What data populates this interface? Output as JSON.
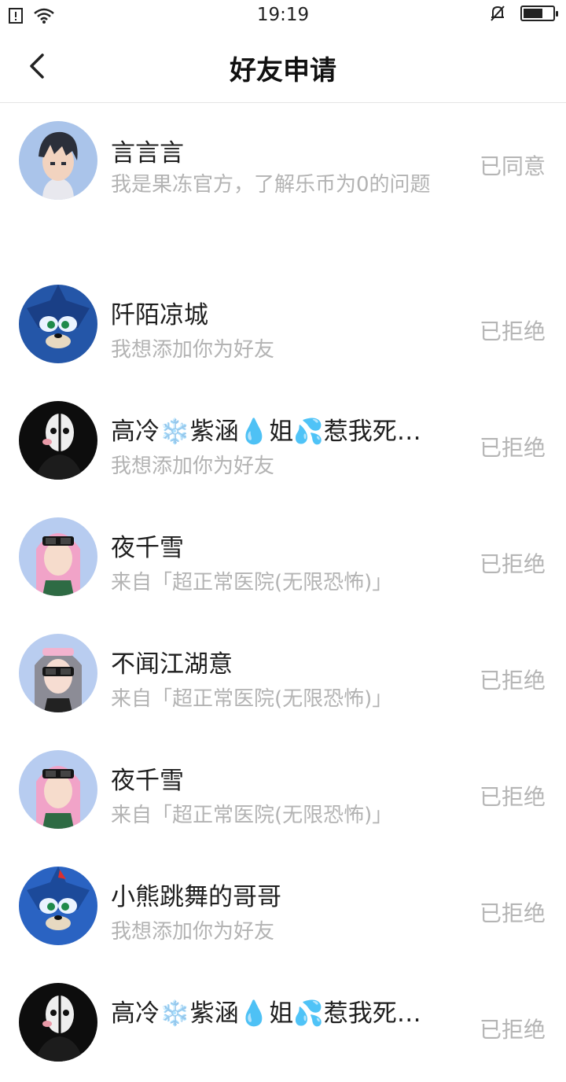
{
  "status_bar": {
    "time": "19:19"
  },
  "header": {
    "title": "好友申请"
  },
  "requests": [
    {
      "name": "言言言",
      "message": "我是果冻官方，了解乐币为0的问题",
      "status": "已同意",
      "avatar": "anime-boy-avatar"
    },
    {
      "name": "阡陌凉城",
      "message": "我想添加你为好友",
      "status": "已拒绝",
      "avatar": "blue-hedgehog-avatar"
    },
    {
      "name": "高冷❄️紫涵💧姐💦惹我死…",
      "message": "我想添加你为好友",
      "status": "已拒绝",
      "avatar": "dark-mask-avatar"
    },
    {
      "name": "夜千雪",
      "message": "来自「超正常医院(无限恐怖)」",
      "status": "已拒绝",
      "avatar": "pink-hair-girl-avatar"
    },
    {
      "name": "不闻江湖意",
      "message": "来自「超正常医院(无限恐怖)」",
      "status": "已拒绝",
      "avatar": "silver-hair-girl-avatar"
    },
    {
      "name": "夜千雪",
      "message": "来自「超正常医院(无限恐怖)」",
      "status": "已拒绝",
      "avatar": "pink-hair-girl-avatar"
    },
    {
      "name": "小熊跳舞的哥哥",
      "message": "我想添加你为好友",
      "status": "已拒绝",
      "avatar": "blue-hedgehog-avatar"
    },
    {
      "name": "高冷❄️紫涵💧姐💦惹我死…",
      "message": "",
      "status": "已拒绝",
      "avatar": "dark-mask-avatar"
    }
  ]
}
